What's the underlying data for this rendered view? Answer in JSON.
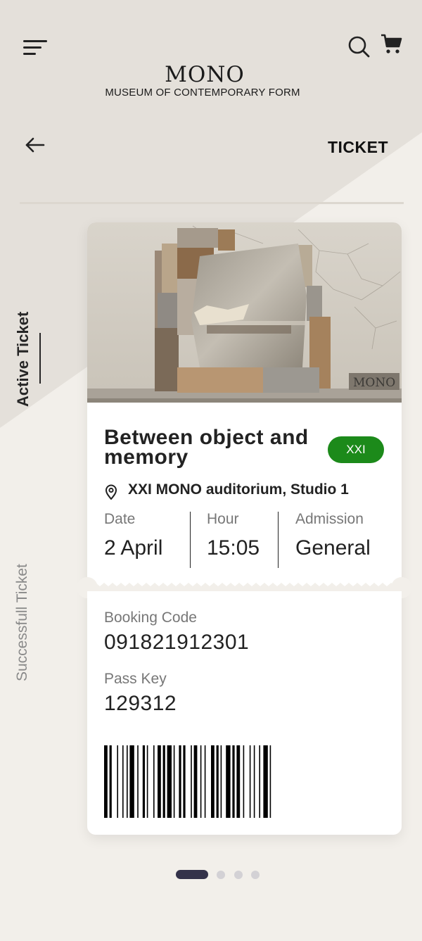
{
  "header": {
    "logo_title": "MONO",
    "logo_subtitle": "MUSEUM OF CONTEMPORARY FORM",
    "page_title": "TICKET",
    "icons": [
      "menu-icon",
      "search-icon",
      "cart-icon",
      "back-arrow-icon"
    ]
  },
  "tabs": {
    "active": "Active Ticket",
    "successful": "Successfull Ticket"
  },
  "ticket": {
    "image_watermark": "MONO",
    "event_title": "Between object and memory",
    "badge": "XXI",
    "venue": "XXI MONO auditorium, Studio 1",
    "date_label": "Date",
    "date_value": "2 April",
    "hour_label": "Hour",
    "hour_value": "15:05",
    "admission_label": "Admission",
    "admission_value": "General",
    "booking_label": "Booking Code",
    "booking_value": "091821912301",
    "pass_label": "Pass Key",
    "pass_value": "129312"
  },
  "pager": {
    "count": 4,
    "active_index": 0
  },
  "colors": {
    "background": "#f2efea",
    "wedge": "#e4e0da",
    "badge": "#1c8a1a",
    "pager_active": "#34324a",
    "pager_inactive": "#d3d1d5"
  }
}
